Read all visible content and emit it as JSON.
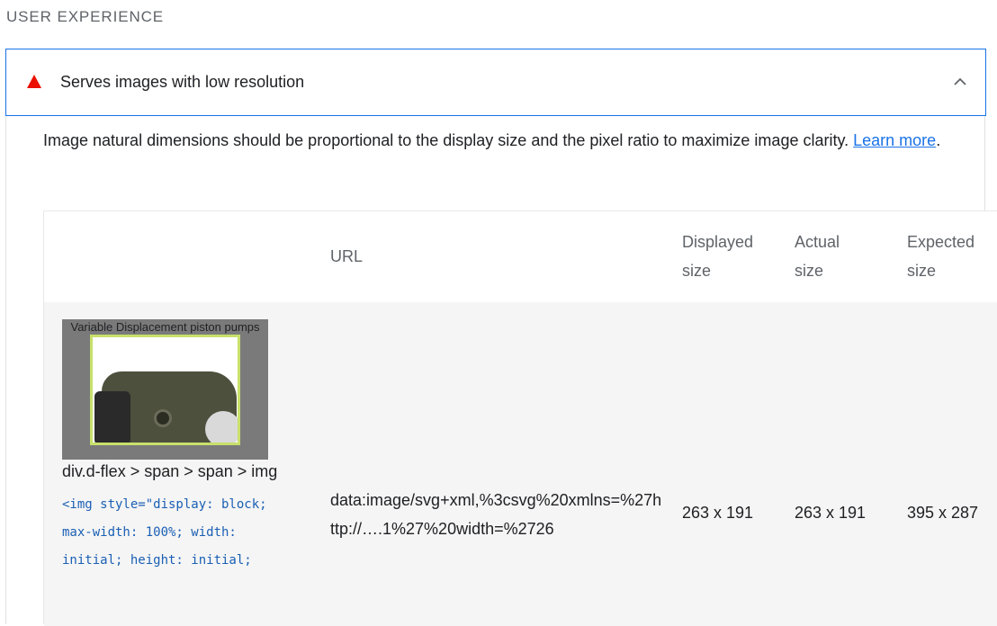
{
  "section": {
    "title": "USER EXPERIENCE"
  },
  "audit": {
    "title": "Serves images with low resolution",
    "status_icon": "fail-triangle-icon",
    "status_color": "#eb0f00",
    "expanded": true,
    "description": "Image natural dimensions should be proportional to the display size and the pixel ratio to maximize image clarity. ",
    "learn_more": "Learn more",
    "description_end": "."
  },
  "table": {
    "headers": {
      "url": "URL",
      "displayed_line1": "Displayed",
      "displayed_line2": "size",
      "actual_line1": "Actual",
      "actual_line2": "size",
      "expected_line1": "Expected",
      "expected_line2": "size"
    },
    "rows": [
      {
        "thumbnail_caption": "Variable Displacement piston pumps",
        "node_path": "div.d-flex > span > span > img",
        "node_snippet": "<img style=\"display: block; max-width: 100%; width: initial; height: initial;",
        "url": "data:image/svg+xml,%3csvg%20xmlns=%27http://….1%27%20width=%2726",
        "displayed_size": "263 x 191",
        "actual_size": "263 x 191",
        "expected_size": "395 x 287"
      }
    ]
  }
}
